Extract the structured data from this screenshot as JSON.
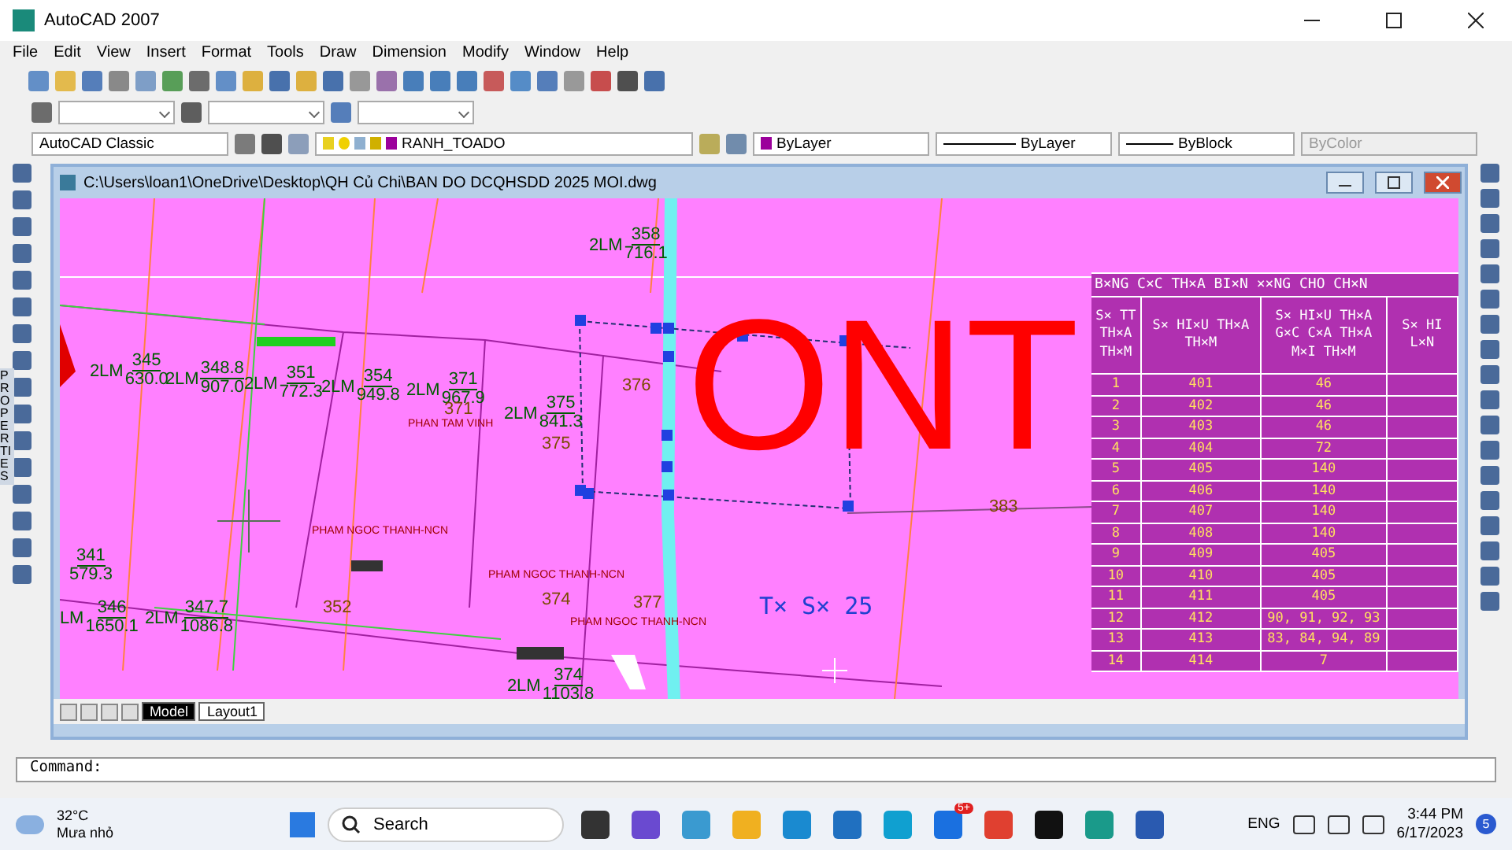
{
  "window": {
    "title": "AutoCAD 2007"
  },
  "menu": [
    "File",
    "Edit",
    "View",
    "Insert",
    "Format",
    "Tools",
    "Draw",
    "Dimension",
    "Modify",
    "Window",
    "Help"
  ],
  "workspace": "AutoCAD Classic",
  "layer": "RANH_TOADO",
  "properties": [
    {
      "kind": "color",
      "value": "ByLayer",
      "disabled": false
    },
    {
      "kind": "linetype",
      "value": "ByLayer",
      "disabled": false
    },
    {
      "kind": "lineweight",
      "value": "ByBlock",
      "disabled": false
    },
    {
      "kind": "plain",
      "value": "ByColor",
      "disabled": true
    }
  ],
  "side_panel": "PROPERTIES",
  "drawing": {
    "title": "C:\\Users\\loan1\\OneDrive\\Desktop\\QH Củ Chi\\BAN DO DCQHSDD 2025 MOI.dwg",
    "parcels": [
      {
        "code": "2LM",
        "number": "358",
        "area": "716.1"
      },
      {
        "code": "2LM",
        "number": "345",
        "area": "630.0"
      },
      {
        "code": "2LM",
        "number": "348.8",
        "area": "907.0"
      },
      {
        "code": "2LM",
        "number": "351",
        "area": "772.3"
      },
      {
        "code": "2LM",
        "number": "354",
        "area": "949.8"
      },
      {
        "code": "2LM",
        "number": "371",
        "area": "967.9"
      },
      {
        "code": "2LM",
        "number": "375",
        "area": "841.3"
      },
      {
        "number": "341",
        "area": "579.3"
      },
      {
        "code": "LM",
        "number": "346",
        "area": "1650.1"
      },
      {
        "code": "2LM",
        "number": "347.7",
        "area": "1086.8"
      },
      {
        "code": "2LM",
        "number": "374",
        "area": "1103.8"
      }
    ],
    "plot_numbers": [
      "371",
      "375",
      "376",
      "352",
      "374",
      "377",
      "383"
    ],
    "owners": [
      "PHAN TAM VINH",
      "PHAM NGOC THANH-NCN",
      "PHAM NGOC THANH-NCN",
      "PHAM NGOC THANH-NCN"
    ],
    "zone_code": "ONT",
    "sheet_label": "T× S× 25",
    "table": {
      "title": "B×NG C×C TH×A BI×N ××NG CHO CH×N",
      "columns": [
        "S× TT TH×A TH×M",
        "S× HI×U TH×A TH×M",
        "S× HI×U TH×A G×C C×A TH×A M×I TH×M",
        "S× HI L×N"
      ],
      "rows": [
        [
          "1",
          "401",
          "46"
        ],
        [
          "2",
          "402",
          "46"
        ],
        [
          "3",
          "403",
          "46"
        ],
        [
          "4",
          "404",
          "72"
        ],
        [
          "5",
          "405",
          "140"
        ],
        [
          "6",
          "406",
          "140"
        ],
        [
          "7",
          "407",
          "140"
        ],
        [
          "8",
          "408",
          "140"
        ],
        [
          "9",
          "409",
          "405"
        ],
        [
          "10",
          "410",
          "405"
        ],
        [
          "11",
          "411",
          "405"
        ],
        [
          "12",
          "412",
          "90, 91, 92, 93"
        ],
        [
          "13",
          "413",
          "83, 84, 94, 89"
        ],
        [
          "14",
          "414",
          "7"
        ]
      ]
    },
    "tabs": [
      {
        "label": "Model",
        "selected": true
      },
      {
        "label": "Layout1",
        "selected": false
      }
    ]
  },
  "command": "Command:",
  "taskbar": {
    "weather_temp": "32°C",
    "weather_text": "Mưa nhỏ",
    "search": "Search",
    "chat_badge": "5+",
    "language": "ENG",
    "time": "3:44 PM",
    "date": "6/17/2023",
    "notifications": "5"
  }
}
